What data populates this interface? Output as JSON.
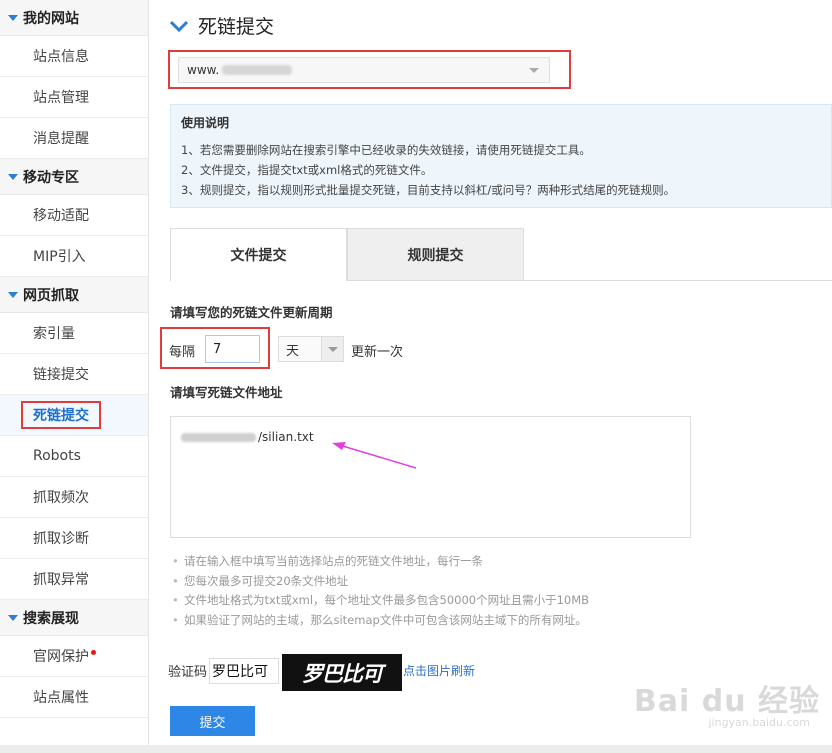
{
  "sidebar": {
    "sections": [
      {
        "title": "我的网站",
        "items": [
          "站点信息",
          "站点管理",
          "消息提醒"
        ]
      },
      {
        "title": "移动专区",
        "items": [
          "移动适配",
          "MIP引入"
        ]
      },
      {
        "title": "网页抓取",
        "items": [
          "索引量",
          "链接提交",
          "死链提交",
          "Robots",
          "抓取频次",
          "抓取诊断",
          "抓取异常"
        ]
      },
      {
        "title": "搜索展现",
        "items": [
          "官网保护",
          "站点属性"
        ]
      }
    ],
    "active_item": "死链提交"
  },
  "page": {
    "title": "死链提交",
    "site_select": {
      "value_prefix": "www."
    },
    "usage": {
      "title": "使用说明",
      "lines": [
        "1、若您需要删除网站在搜索引擎中已经收录的失效链接，请使用死链提交工具。",
        "2、文件提交，指提交txt或xml格式的死链文件。",
        "3、规则提交，指以规则形式批量提交死链，目前支持以斜杠/或问号？两种形式结尾的死链规则。"
      ]
    },
    "tabs": [
      {
        "label": "文件提交",
        "active": true
      },
      {
        "label": "规则提交",
        "active": false
      }
    ],
    "period": {
      "label": "请填写您的死链文件更新周期",
      "every": "每隔",
      "value": "7",
      "unit": "天",
      "suffix": "更新一次"
    },
    "url": {
      "label": "请填写死链文件地址",
      "value_suffix": "/silian.txt"
    },
    "notes": [
      "请在输入框中填写当前选择站点的死链文件地址，每行一条",
      "您每次最多可提交20条文件地址",
      "文件地址格式为txt或xml，每个地址文件最多包含50000个网址且需小于10MB",
      "如果验证了网站的主域，那么sitemap文件中可包含该网站主域下的所有网址。"
    ],
    "captcha": {
      "label": "验证码",
      "value": "罗巴比可",
      "image_text": "罗巴比可",
      "refresh": "点击图片刷新"
    },
    "submit_label": "提交"
  },
  "watermark": {
    "main": "Bai du 经验",
    "sub": "jingyan.baidu.com"
  },
  "colors": {
    "accent": "#2e86e6",
    "highlight_red": "#e23b3b",
    "link": "#2a6fc9",
    "annotation_arrow": "#e040e0"
  }
}
